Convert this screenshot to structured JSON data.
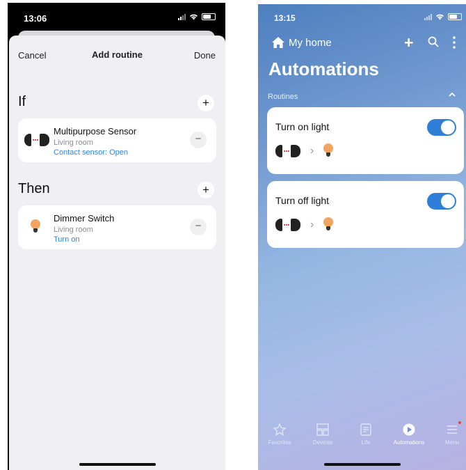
{
  "left": {
    "status": {
      "time": "13:06"
    },
    "header": {
      "cancel": "Cancel",
      "title": "Add routine",
      "done": "Done"
    },
    "if_section": {
      "label": "If",
      "add": "+",
      "card": {
        "name": "Multipurpose Sensor",
        "room": "Living room",
        "detail": "Contact sensor: Open",
        "remove": "−",
        "icon": "sensor-icon"
      }
    },
    "then_section": {
      "label": "Then",
      "add": "+",
      "card": {
        "name": "Dimmer Switch",
        "room": "Living room",
        "detail": "Turn on",
        "remove": "−",
        "icon": "bulb-icon"
      }
    }
  },
  "right": {
    "status": {
      "time": "13:15"
    },
    "header": {
      "home": "My home"
    },
    "page_title": "Automations",
    "section_label": "Routines",
    "routines": [
      {
        "name": "Turn on light",
        "enabled": true
      },
      {
        "name": "Turn off light",
        "enabled": true
      }
    ],
    "tabs": [
      {
        "label": "Favorites",
        "icon": "star-icon"
      },
      {
        "label": "Devices",
        "icon": "devices-icon"
      },
      {
        "label": "Life",
        "icon": "life-icon"
      },
      {
        "label": "Automations",
        "icon": "play-icon",
        "active": true
      },
      {
        "label": "Menu",
        "icon": "menu-icon"
      }
    ]
  },
  "colors": {
    "accent_blue": "#2f7fd8",
    "link_blue": "#2f86d8",
    "bulb_orange": "#f2a460",
    "sheet_bg": "#efeff4"
  }
}
